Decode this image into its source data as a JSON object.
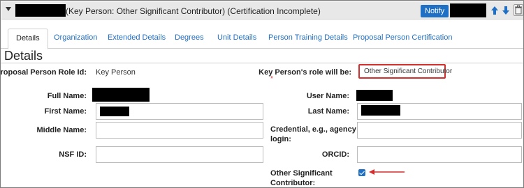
{
  "header": {
    "title": "(Key Person: Other Significant Contributor) (Certification Incomplete)",
    "notify_label": "Notify",
    "icons": [
      "collapse-caret-icon",
      "arrow-up-icon",
      "arrow-down-icon",
      "trash-icon"
    ]
  },
  "tabs": [
    {
      "label": "Details",
      "active": true
    },
    {
      "label": "Organization"
    },
    {
      "label": "Extended Details"
    },
    {
      "label": "Degrees"
    },
    {
      "label": "Unit Details"
    },
    {
      "label": "Person Training Details"
    },
    {
      "label": "Proposal Person Certification"
    }
  ],
  "section": {
    "title": "Details"
  },
  "form": {
    "role_id_label": "Proposal Person Role Id:",
    "role_id_value": "Key Person",
    "role_will_be_label": "Key Person's role will be:",
    "role_will_be_value": "Other Significant Contributor",
    "required_marker": "*",
    "full_name_label": "Full Name:",
    "user_name_label": "User Name:",
    "first_name_label": "First Name:",
    "last_name_label": "Last Name:",
    "middle_name_label": "Middle Name:",
    "credential_label_line1": "Credential, e.g., agency",
    "credential_label_line2": "login:",
    "nsf_id_label": "NSF ID:",
    "orcid_label": "ORCID:",
    "osc_label_line1": "Other Significant",
    "osc_label_line2": "Contributor:",
    "osc_checked": true
  },
  "colors": {
    "accent": "#1f6fc5",
    "highlight": "#d32f2f",
    "header_bg": "#e8e8e8"
  }
}
